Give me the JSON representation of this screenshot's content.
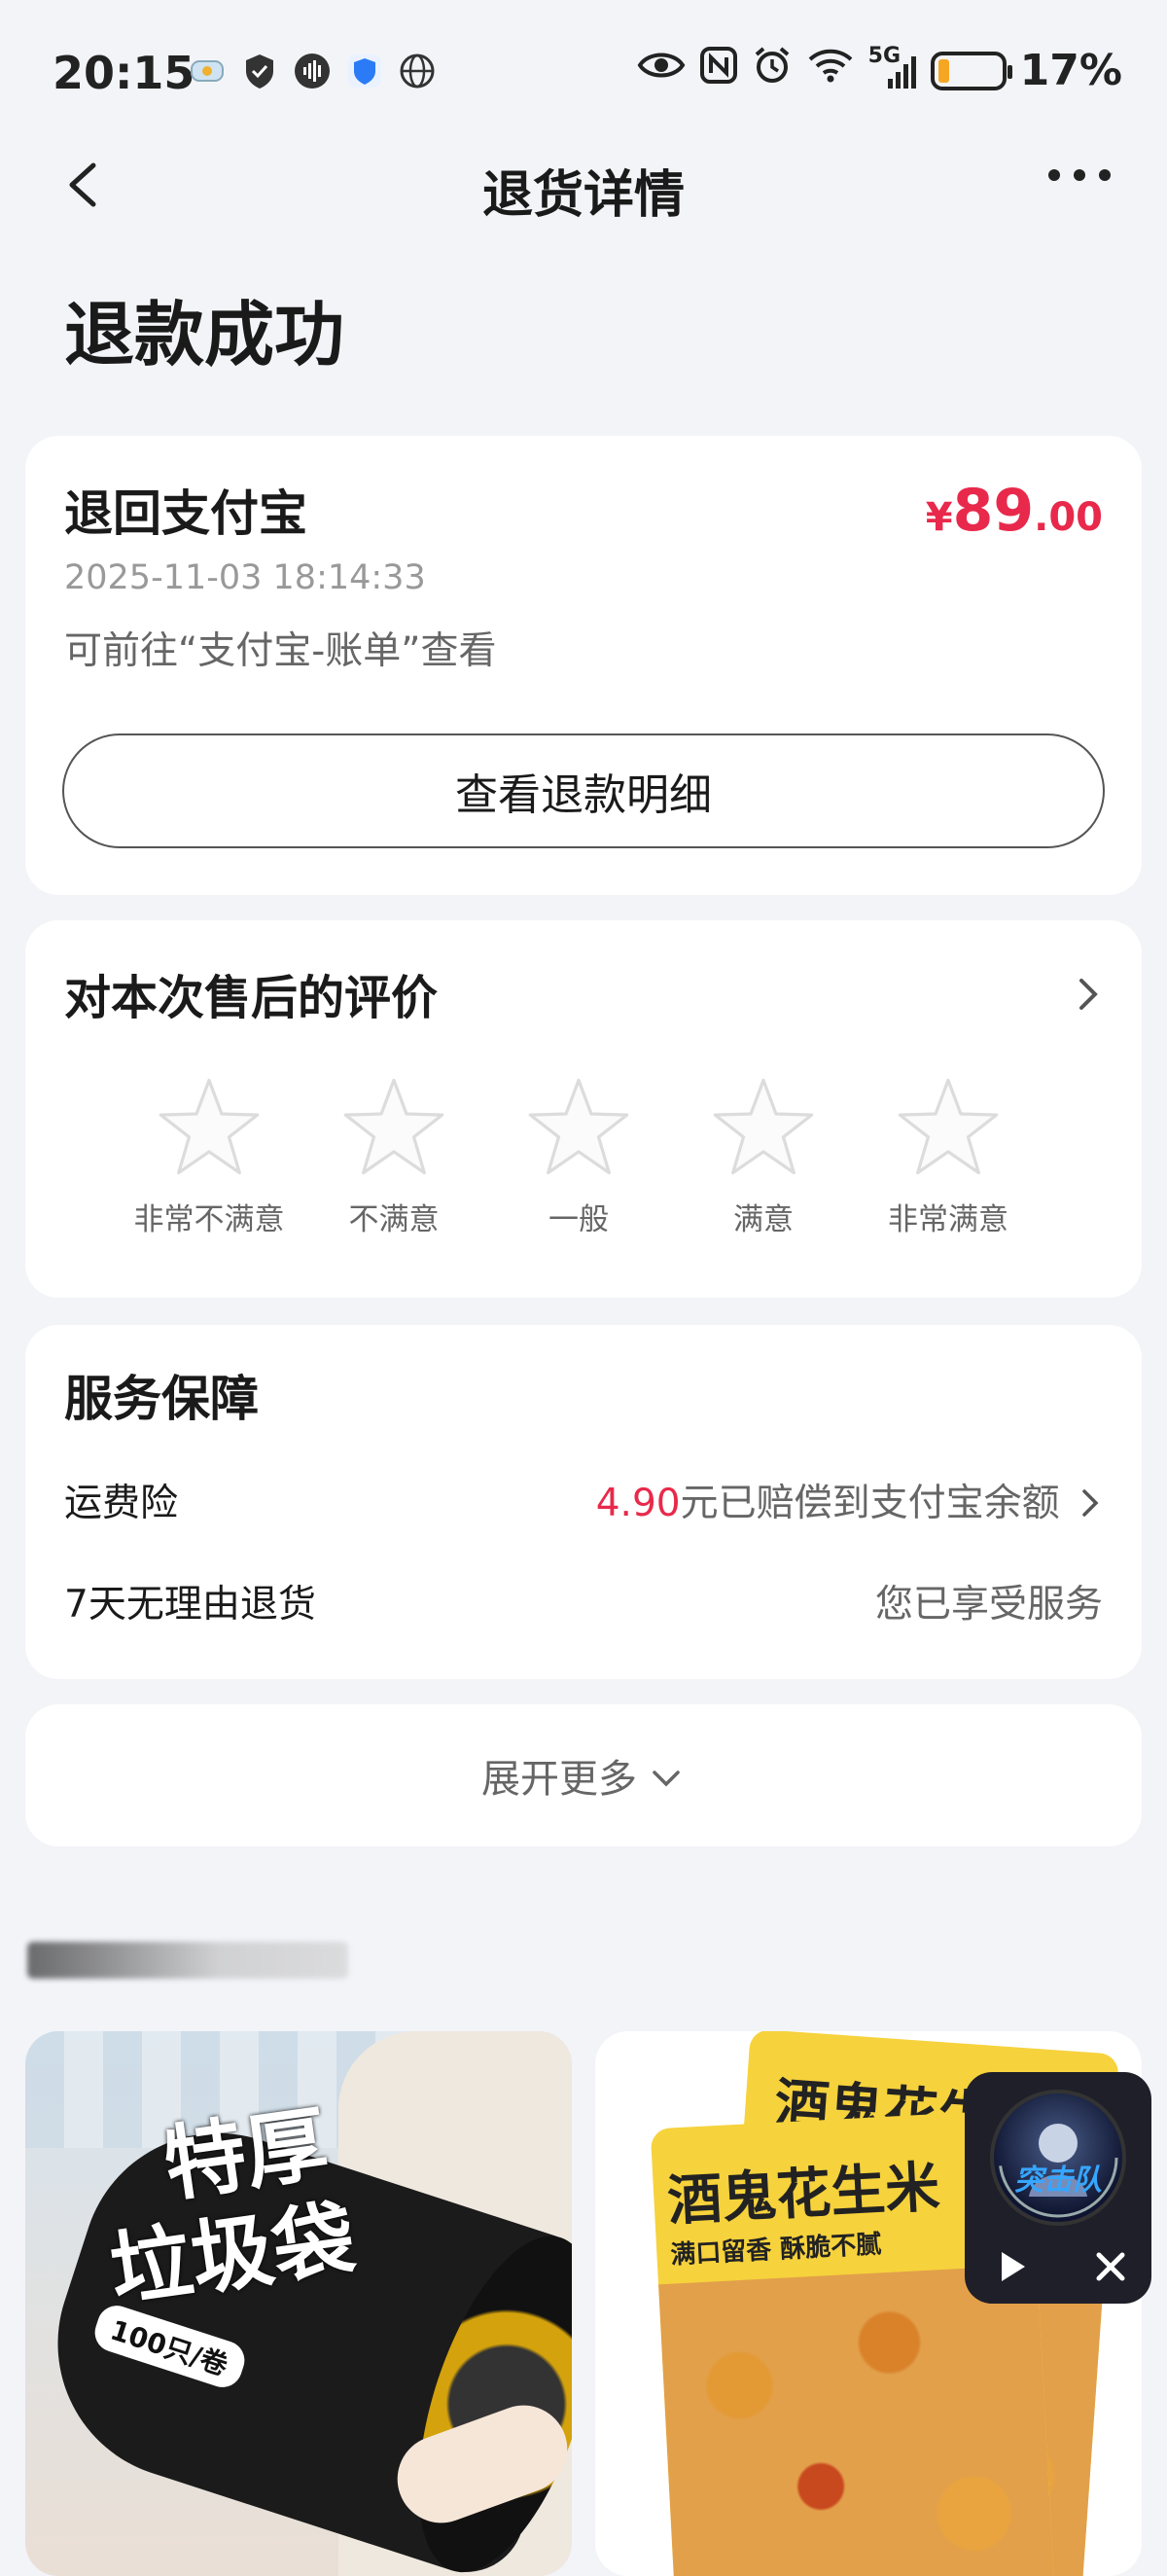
{
  "status_bar": {
    "time": "20:15",
    "network": "5G",
    "battery_percent": "17%",
    "battery_level": 0.17,
    "battery_color": "#f5a623",
    "icons_left": [
      "app-badge-icon",
      "shield-icon",
      "voice-icon",
      "security-icon",
      "globe-icon"
    ],
    "icons_right": [
      "eye-icon",
      "nfc-icon",
      "alarm-icon",
      "wifi-icon",
      "signal-icon",
      "battery-icon"
    ]
  },
  "nav": {
    "title": "退货详情",
    "back_icon": "chevron-left-icon",
    "more_icon": "more-dots-icon"
  },
  "page_title": "退款成功",
  "refund": {
    "destination": "退回支付宝",
    "amount_currency": "¥",
    "amount_int": "89",
    "amount_dec": ".00",
    "time": "2025-11-03 18:14:33",
    "note": "可前往“支付宝-账单”查看",
    "detail_button": "查看退款明细",
    "accent_color": "#e8294b"
  },
  "rating": {
    "title": "对本次售后的评价",
    "options": [
      {
        "label": "非常不满意"
      },
      {
        "label": "不满意"
      },
      {
        "label": "一般"
      },
      {
        "label": "满意"
      },
      {
        "label": "非常满意"
      }
    ]
  },
  "service": {
    "title": "服务保障",
    "rows": [
      {
        "label": "运费险",
        "value_red": "4.90",
        "value": "元已赔偿到支付宝余额"
      },
      {
        "label": "7天无理由退货",
        "value_red": "",
        "value": "您已享受服务"
      }
    ]
  },
  "expand": {
    "label": "展开更多"
  },
  "products": [
    {
      "title_lines": [
        "特厚",
        "垃圾袋"
      ],
      "tag": "100只/卷"
    },
    {
      "title": "酒鬼花生米",
      "title_back": "酒鬼花生",
      "slogan": "满口留香 酥脆不腻"
    }
  ],
  "float_player": {
    "brand": "突击队"
  }
}
